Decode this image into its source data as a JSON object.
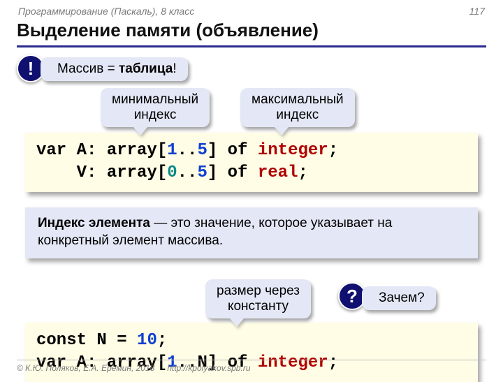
{
  "header": {
    "course": "Программирование (Паскаль), 8 класс",
    "page": "117"
  },
  "title": "Выделение памяти (объявление)",
  "badge1": "!",
  "hint_array_eq": "Массив = ",
  "hint_array_table": "таблица",
  "hint_array_bang": "!",
  "label_min_index": "минимальный\nиндекс",
  "label_max_index": "максимальный\nиндекс",
  "code1": {
    "l1_a": "var A: array[",
    "l1_b": "1",
    "l1_c": "..",
    "l1_d": "5",
    "l1_e": "] of ",
    "l1_f": "integer",
    "l1_g": ";",
    "l2_a": "    V: array[",
    "l2_b": "0",
    "l2_c": "..",
    "l2_d": "5",
    "l2_e": "] of ",
    "l2_f": "real",
    "l2_g": ";"
  },
  "defn": {
    "term": "Индекс элемента",
    "rest": " — это значение, которое указывает на конкретный элемент массива."
  },
  "label_size_const": "размер через\nконстанту",
  "badge2": "?",
  "why": "Зачем?",
  "code2": {
    "l1_a": "const N",
    "l1_b": " = ",
    "l1_c": "10",
    "l1_d": ";",
    "l2_a": "var A: array[",
    "l2_b": "1",
    "l2_c": "..N] of ",
    "l2_d": "integer",
    "l2_e": ";"
  },
  "footer": {
    "copyright": "© К.Ю. Поляков, Е.А. Ерёмин, 2018",
    "url": "http://kpolyakov.spb.ru"
  }
}
